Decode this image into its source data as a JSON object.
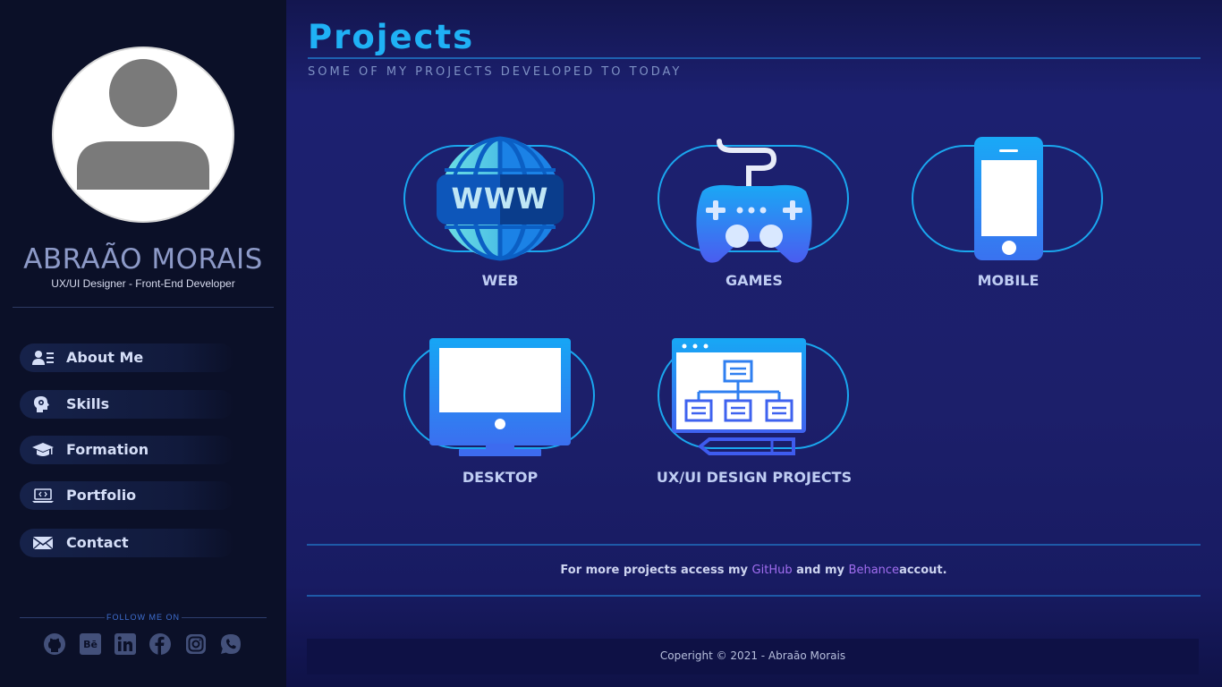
{
  "profile": {
    "name": "ABRAÃO MORAIS",
    "role": "UX/UI Designer - Front-End Developer"
  },
  "nav": {
    "items": [
      {
        "label": "About Me",
        "icon": "user-card-icon"
      },
      {
        "label": "Skills",
        "icon": "head-gear-icon"
      },
      {
        "label": "Formation",
        "icon": "graduation-cap-icon"
      },
      {
        "label": "Portfolio",
        "icon": "laptop-code-icon"
      },
      {
        "label": "Contact",
        "icon": "envelope-icon"
      }
    ]
  },
  "follow": {
    "label": "FOLLOW ME ON",
    "networks": [
      "github-icon",
      "behance-icon",
      "linkedin-icon",
      "facebook-icon",
      "instagram-icon",
      "whatsapp-icon"
    ]
  },
  "main": {
    "title": "Projects",
    "subtitle": "SOME OF MY PROJECTS DEVELOPED TO TODAY",
    "cards": [
      {
        "label": "WEB",
        "icon": "globe-www-icon"
      },
      {
        "label": "GAMES",
        "icon": "gamepad-icon"
      },
      {
        "label": "MOBILE",
        "icon": "smartphone-icon"
      },
      {
        "label": "DESKTOP",
        "icon": "monitor-icon"
      },
      {
        "label": "UX/UI DESIGN PROJECTS",
        "icon": "wireframe-icon"
      }
    ],
    "more": {
      "prefix": "For more projects access my",
      "github": "GitHub",
      "middle": "and my",
      "behance": "Behance",
      "suffix": "accout."
    },
    "footer": "Coperight © 2021 - Abraão Morais"
  },
  "colors": {
    "accent": "#1fb1f5",
    "sidebar_bg": "#0b1028",
    "main_bg": "#1c2070",
    "link": "#a16ef0"
  }
}
